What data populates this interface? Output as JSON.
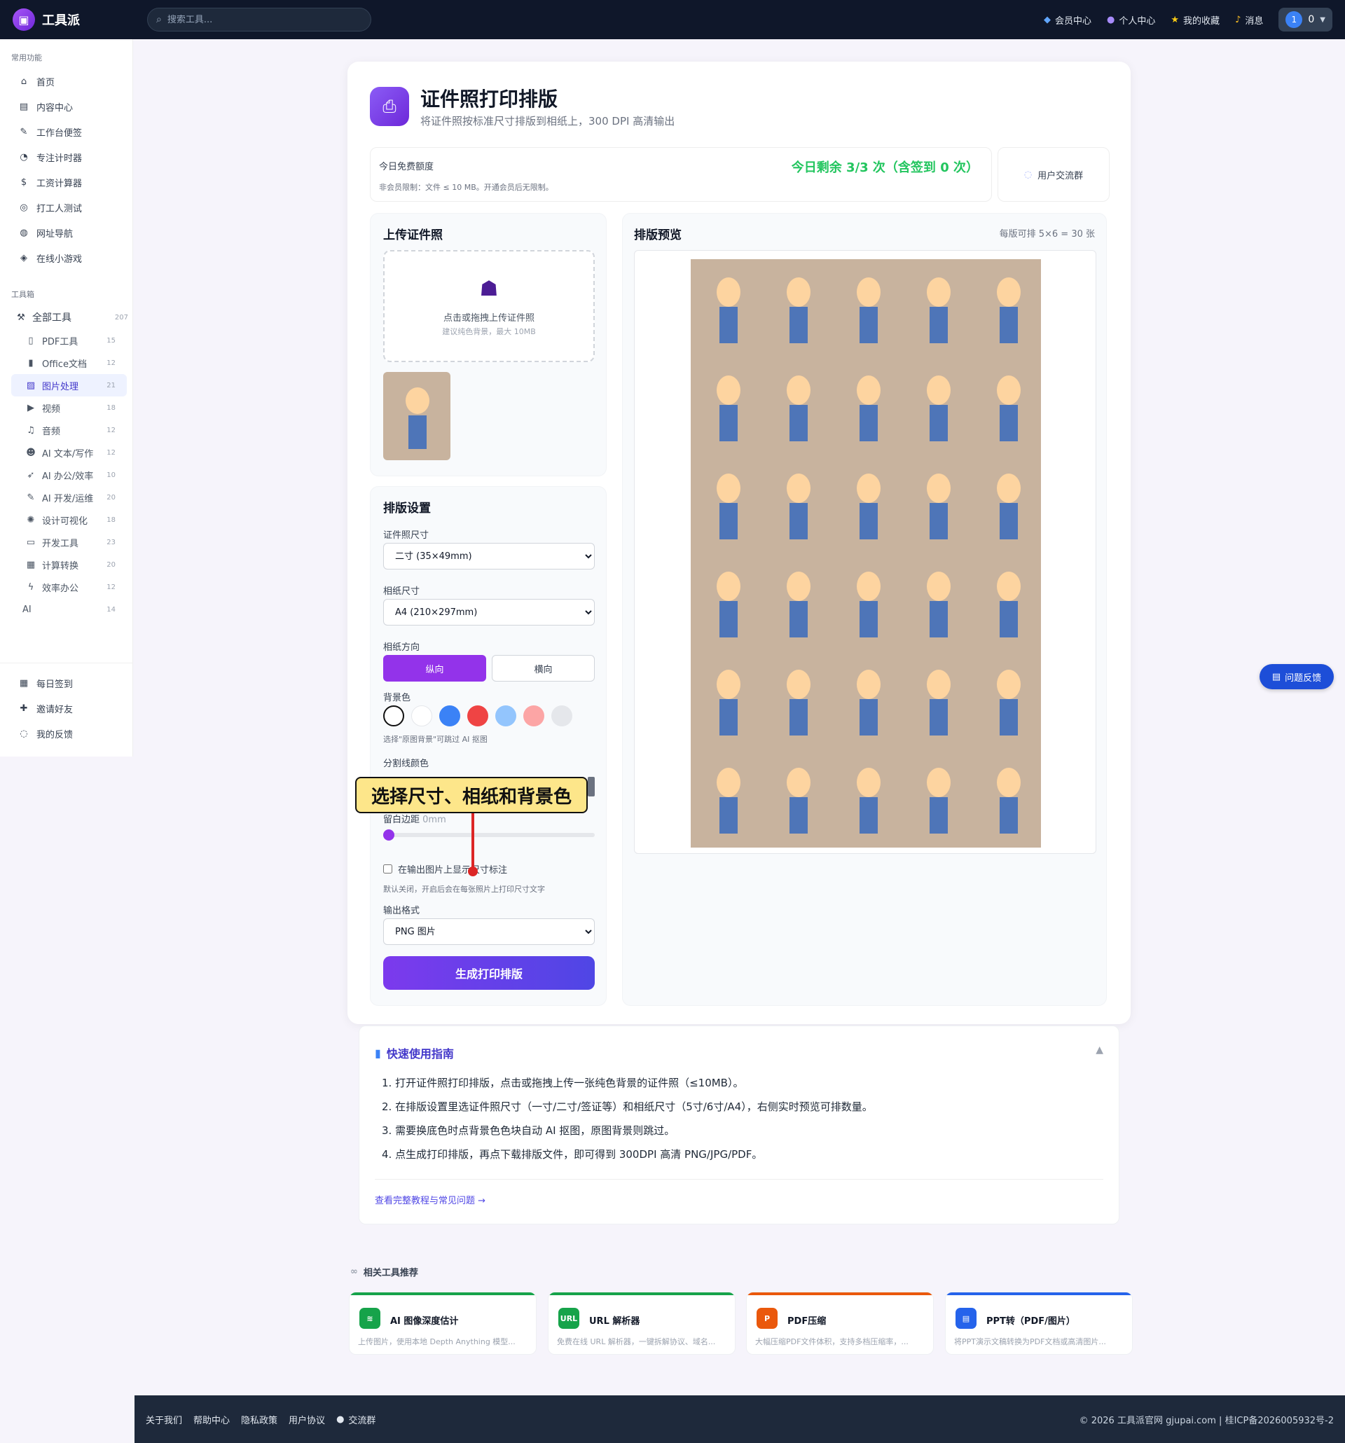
{
  "topbar": {
    "app_name": "工具派",
    "search_placeholder": "搜索工具...",
    "links": [
      "会员中心",
      "个人中心",
      "我的收藏",
      "消息"
    ],
    "user_avatar": "1",
    "user_count": "0"
  },
  "sidebar": {
    "section_common": "常用功能",
    "common": [
      "首页",
      "内容中心",
      "工作台便签",
      "专注计时器",
      "工资计算器",
      "打工人测试",
      "网址导航",
      "在线小游戏"
    ],
    "section_tools": "工具箱",
    "all_tools": {
      "label": "全部工具",
      "count": "207"
    },
    "tools": [
      {
        "label": "PDF工具",
        "count": "15"
      },
      {
        "label": "Office文档",
        "count": "12"
      },
      {
        "label": "图片处理",
        "count": "21"
      },
      {
        "label": "视频",
        "count": "18"
      },
      {
        "label": "音频",
        "count": "12"
      },
      {
        "label": "AI 文本/写作",
        "count": "12"
      },
      {
        "label": "AI 办公/效率",
        "count": "10"
      },
      {
        "label": "AI 开发/运维",
        "count": "20"
      },
      {
        "label": "设计可视化",
        "count": "18"
      },
      {
        "label": "开发工具",
        "count": "23"
      },
      {
        "label": "计算转换",
        "count": "20"
      },
      {
        "label": "效率办公",
        "count": "12"
      },
      {
        "label": "AI",
        "count": "14"
      }
    ],
    "bottom": [
      "每日签到",
      "邀请好友",
      "我的反馈"
    ]
  },
  "header": {
    "title": "证件照打印排版",
    "subtitle": "将证件照按标准尺寸排版到相纸上，300 DPI 高清输出"
  },
  "quota": {
    "label": "今日免费额度",
    "limit": "非会员限制：文件 ≤ 10 MB。开通会员后无限制。",
    "remaining": "今日剩余 3/3 次（含签到 0 次）",
    "group_button": "用户交流群"
  },
  "upload": {
    "title": "上传证件照",
    "hint": "点击或拖拽上传证件照",
    "sub": "建议纯色背景，最大 10MB"
  },
  "settings": {
    "title": "排版设置",
    "photo_size_label": "证件照尺寸",
    "photo_size_value": "二寸 (35×49mm)",
    "paper_size_label": "相纸尺寸",
    "paper_size_value": "A4 (210×297mm)",
    "orientation_label": "相纸方向",
    "portrait": "纵向",
    "landscape": "横向",
    "bg_label": "背景色",
    "bg_colors": [
      "#ffffff",
      "#ffffff",
      "#3b82f6",
      "#ef4444",
      "#93c5fd",
      "#fca5a5",
      "#e5e7eb"
    ],
    "bg_hint": "选择\"原图背景\"可跳过 AI 抠图",
    "divider_label": "分割线颜色",
    "margin_label": "留白边距",
    "margin_value": "0mm",
    "margin_fraction": 0,
    "show_size_label": "在输出图片上显示尺寸标注",
    "show_size_hint": "默认关闭，开启后会在每张照片上打印尺寸文字",
    "format_label": "输出格式",
    "format_value": "PNG 图片",
    "generate": "生成打印排版"
  },
  "tooltip": "选择尺寸、相纸和背景色",
  "preview": {
    "title": "排版预览",
    "capacity": "每版可排 5×6 = 30 张",
    "cols": 5,
    "rows": 6
  },
  "feedback_button": "问题反馈",
  "guide": {
    "title": "快速使用指南",
    "steps": [
      "1. 打开证件照打印排版，点击或拖拽上传一张纯色背景的证件照（≤10MB）。",
      "2. 在排版设置里选证件照尺寸（一寸/二寸/签证等）和相纸尺寸（5寸/6寸/A4），右侧实时预览可排数量。",
      "3. 需要换底色时点背景色色块自动 AI 抠图，原图背景则跳过。",
      "4. 点生成打印排版，再点下载排版文件，即可得到 300DPI 高清 PNG/JPG/PDF。"
    ],
    "more": "查看完整教程与常见问题 →"
  },
  "related": {
    "title": "相关工具推荐",
    "items": [
      {
        "title": "AI 图像深度估计",
        "desc": "上传图片，使用本地 Depth Anything 模型...",
        "color": "#16a34a",
        "icon_text": "≋"
      },
      {
        "title": "URL 解析器",
        "desc": "免费在线 URL 解析器，一键拆解协议、域名...",
        "color": "#16a34a",
        "icon_text": "URL"
      },
      {
        "title": "PDF压缩",
        "desc": "大幅压缩PDF文件体积，支持多档压缩率，...",
        "color": "#ea580c",
        "icon_text": "P"
      },
      {
        "title": "PPT转（PDF/图片）",
        "desc": "将PPT演示文稿转换为PDF文档或高清图片...",
        "color": "#2563eb",
        "icon_text": "▤"
      }
    ]
  },
  "footer": {
    "links": [
      "关于我们",
      "帮助中心",
      "隐私政策",
      "用户协议",
      "交流群"
    ],
    "copyright": "© 2026 工具派官网 gjupai.com | 桂ICP备2026005932号-2"
  }
}
